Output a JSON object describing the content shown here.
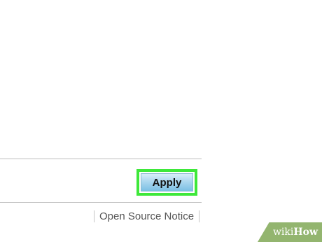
{
  "toolbar": {
    "apply_label": "Apply"
  },
  "footer": {
    "open_source_notice": "Open Source Notice"
  },
  "watermark": {
    "part1": "wiki",
    "part2": "How",
    "color": "#93b56f"
  },
  "highlight": {
    "color": "#3ee83a",
    "target": "apply-button"
  }
}
